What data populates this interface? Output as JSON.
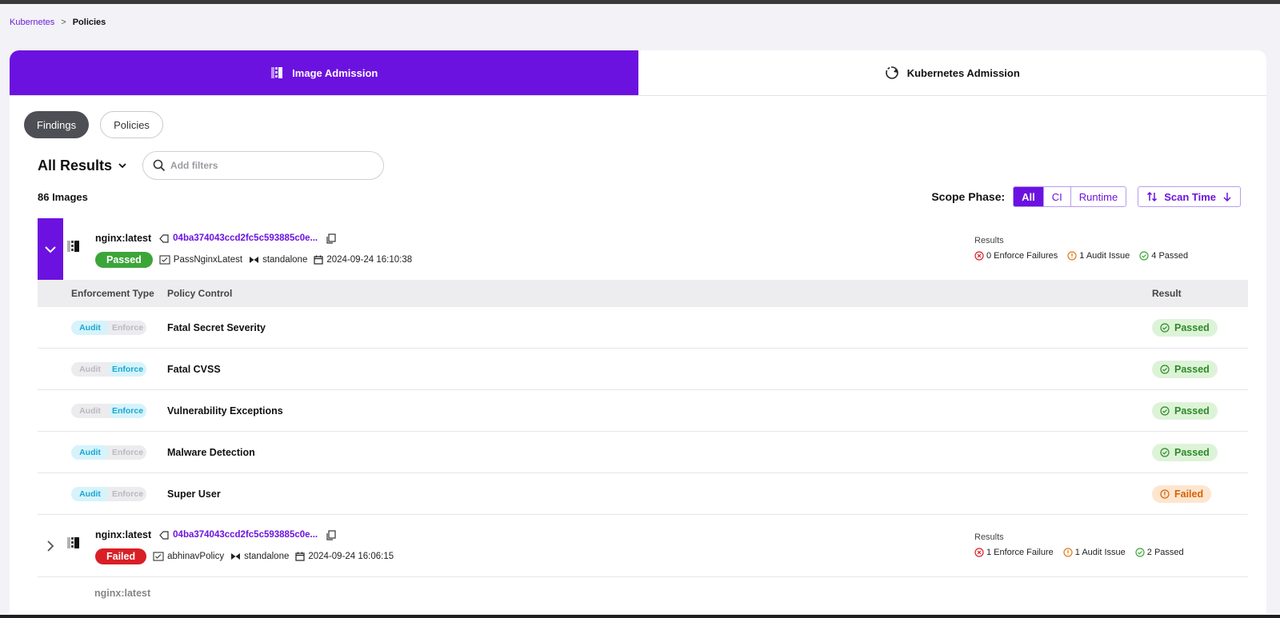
{
  "breadcrumb": {
    "root": "Kubernetes",
    "separator": ">",
    "current": "Policies"
  },
  "admission_tabs": {
    "image": "Image Admission",
    "kubernetes": "Kubernetes Admission"
  },
  "view_tabs": {
    "findings": "Findings",
    "policies": "Policies"
  },
  "results": {
    "title": "All Results",
    "search_placeholder": "Add filters",
    "count": "86 Images"
  },
  "scope": {
    "label": "Scope Phase:",
    "options": [
      "All",
      "CI",
      "Runtime"
    ],
    "selected": "All",
    "sort_label": "Scan Time"
  },
  "colors": {
    "accent": "#6c12e0",
    "pass": "#3ca53a",
    "fail": "#d81f26",
    "warn": "#e07b1a"
  },
  "images": [
    {
      "name": "nginx:latest",
      "digest": "04ba374043ccd2fc5c593885c0e...",
      "status": "Passed",
      "policy": "PassNginxLatest",
      "cluster": "standalone",
      "time": "2024-09-24 16:10:38",
      "results_label": "Results",
      "enforce": "0 Enforce Failures",
      "audit": "1 Audit Issue",
      "passed": "4 Passed"
    },
    {
      "name": "nginx:latest",
      "digest": "04ba374043ccd2fc5c593885c0e...",
      "status": "Failed",
      "policy": "abhinavPolicy",
      "cluster": "standalone",
      "time": "2024-09-24 16:06:15",
      "results_label": "Results",
      "enforce": "1 Enforce Failure",
      "audit": "1 Audit Issue",
      "passed": "2 Passed"
    }
  ],
  "peek_name": "nginx:latest",
  "controls_header": {
    "enforcement": "Enforcement Type",
    "policy": "Policy Control",
    "result": "Result"
  },
  "toggle_labels": {
    "audit": "Audit",
    "enforce": "Enforce"
  },
  "controls": [
    {
      "mode": "Audit",
      "name": "Fatal Secret Severity",
      "result": "Passed"
    },
    {
      "mode": "Enforce",
      "name": "Fatal CVSS",
      "result": "Passed"
    },
    {
      "mode": "Enforce",
      "name": "Vulnerability Exceptions",
      "result": "Passed"
    },
    {
      "mode": "Audit",
      "name": "Malware Detection",
      "result": "Passed"
    },
    {
      "mode": "Audit",
      "name": "Super User",
      "result": "Failed"
    }
  ]
}
